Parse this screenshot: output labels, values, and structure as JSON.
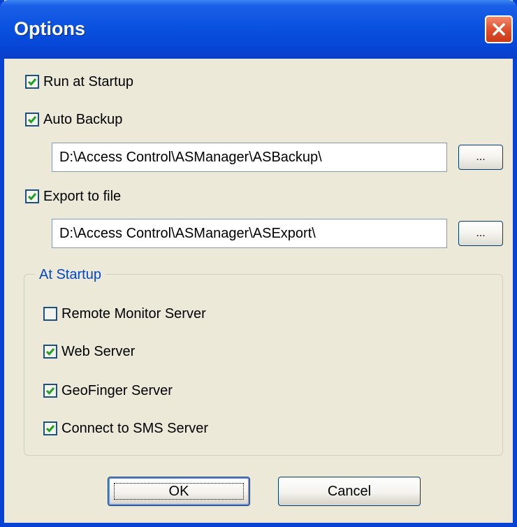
{
  "window": {
    "title": "Options",
    "close_icon": "close-icon"
  },
  "options": {
    "run_at_startup": {
      "label": "Run at Startup",
      "checked": true
    },
    "auto_backup": {
      "label": "Auto Backup",
      "checked": true,
      "path": "D:\\Access Control\\ASManager\\ASBackup\\",
      "browse_label": "..."
    },
    "export_to_file": {
      "label": "Export to file",
      "checked": true,
      "path": "D:\\Access Control\\ASManager\\ASExport\\",
      "browse_label": "..."
    }
  },
  "at_startup": {
    "title": "At Startup",
    "items": [
      {
        "label": "Remote Monitor Server",
        "checked": false
      },
      {
        "label": "Web Server",
        "checked": true
      },
      {
        "label": "GeoFinger Server",
        "checked": true
      },
      {
        "label": "Connect to SMS Server",
        "checked": true
      }
    ]
  },
  "buttons": {
    "ok": "OK",
    "cancel": "Cancel"
  },
  "colors": {
    "titlebar": "#0a52e0",
    "check": "#21a121",
    "group_title": "#0046d5",
    "face": "#ece9d8"
  }
}
